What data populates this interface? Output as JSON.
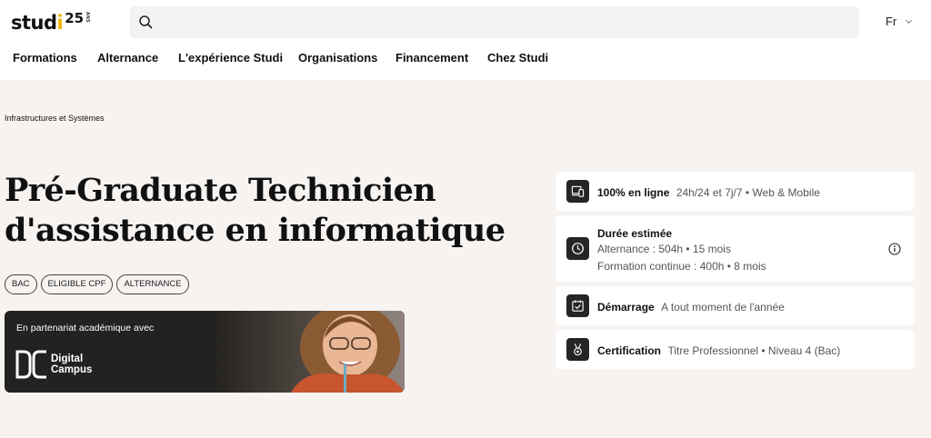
{
  "header": {
    "logo": {
      "word_a": "stud",
      "word_i": "i",
      "anniversary_number": "25",
      "anniversary_unit": "ANS"
    },
    "search": {
      "placeholder": ""
    },
    "language": "Fr"
  },
  "nav": [
    {
      "label": "Formations"
    },
    {
      "label": "Alternance"
    },
    {
      "label": "L'expérience Studi"
    },
    {
      "label": "Organisations"
    },
    {
      "label": "Financement"
    },
    {
      "label": "Chez Studi"
    }
  ],
  "hero": {
    "breadcrumb": "Infrastructures et Systèmes",
    "title_line1": "Pré-Graduate Technicien",
    "title_line2": "d'assistance en informatique",
    "tags": [
      "BAC",
      "ELIGIBLE CPF",
      "ALTERNANCE"
    ],
    "partner": {
      "text": "En partenariat académique avec",
      "name_line1": "Digital",
      "name_line2": "Campus"
    }
  },
  "info_cards": {
    "online": {
      "label": "100% en ligne",
      "value": "24h/24 et 7j/7 • Web & Mobile",
      "icon": "devices-icon"
    },
    "duration": {
      "label": "Durée estimée",
      "line1": "Alternance : 504h • 15 mois",
      "line2": "Formation continue : 400h • 8 mois",
      "icon": "clock-icon"
    },
    "start": {
      "label": "Démarrage",
      "value": "A tout moment de l'année",
      "icon": "calendar-check-icon"
    },
    "certification": {
      "label": "Certification",
      "value": "Titre Professionnel • Niveau 4 (Bac)",
      "icon": "medal-icon"
    }
  },
  "colors": {
    "brand_yellow": "#f2b600",
    "hero_bg": "#f6f3f1",
    "icon_bg": "#252525"
  }
}
